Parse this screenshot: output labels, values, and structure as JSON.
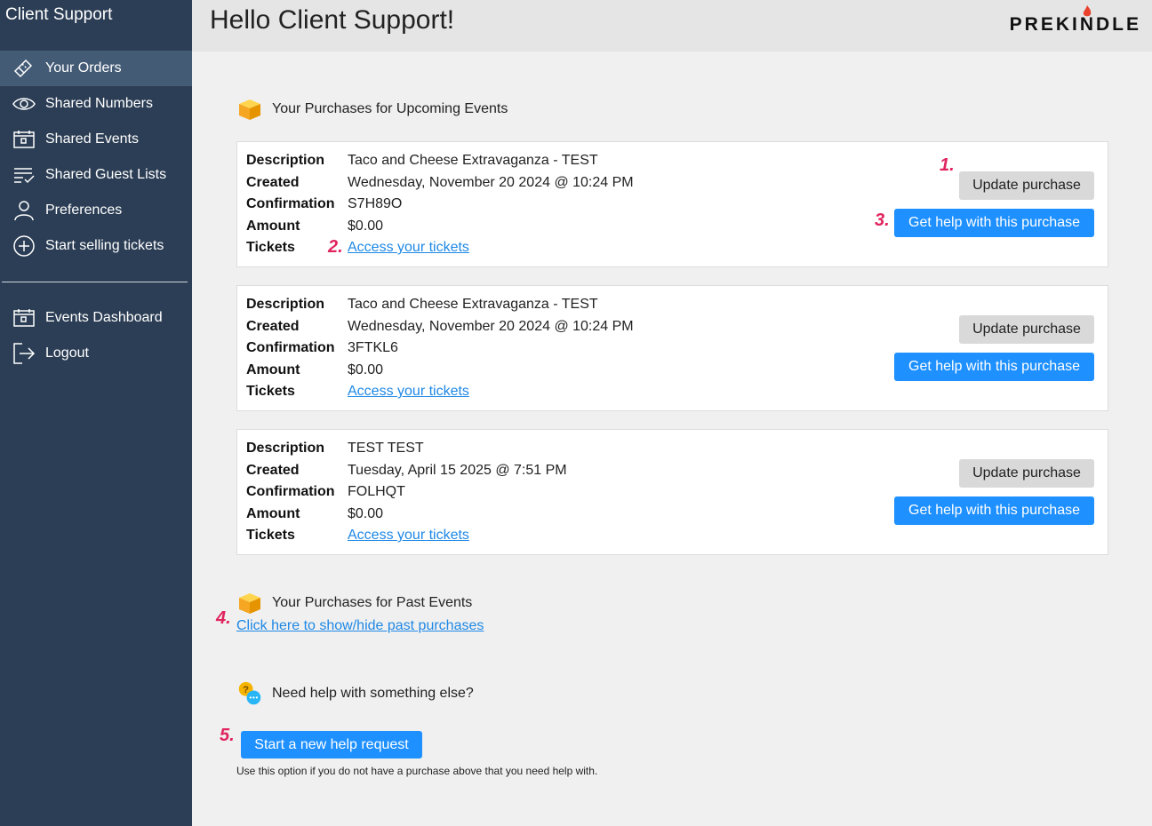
{
  "sidebar": {
    "title": "Client Support",
    "items": [
      {
        "label": "Your Orders",
        "icon": "ticket-icon"
      },
      {
        "label": "Shared Numbers",
        "icon": "eye-icon"
      },
      {
        "label": "Shared Events",
        "icon": "calendar-icon"
      },
      {
        "label": "Shared Guest Lists",
        "icon": "checklist-icon"
      },
      {
        "label": "Preferences",
        "icon": "user-icon"
      },
      {
        "label": "Start selling tickets",
        "icon": "plus-circle-icon"
      }
    ],
    "bottom_items": [
      {
        "label": "Events Dashboard",
        "icon": "calendar-icon"
      },
      {
        "label": "Logout",
        "icon": "logout-icon"
      }
    ]
  },
  "header": {
    "greeting": "Hello Client Support!",
    "brand": "PREKINDLE"
  },
  "upcoming": {
    "heading": "Your Purchases for Upcoming Events",
    "labels": {
      "description": "Description",
      "created": "Created",
      "confirmation": "Confirmation",
      "amount": "Amount",
      "tickets": "Tickets"
    },
    "tickets_link": "Access your tickets",
    "update_label": "Update purchase",
    "help_label": "Get help with this purchase",
    "purchases": [
      {
        "description": "Taco and Cheese Extravaganza - TEST",
        "created": "Wednesday, November 20 2024 @ 10:24 PM",
        "confirmation": "S7H89O",
        "amount": "$0.00"
      },
      {
        "description": "Taco and Cheese Extravaganza - TEST",
        "created": "Wednesday, November 20 2024 @ 10:24 PM",
        "confirmation": "3FTKL6",
        "amount": "$0.00"
      },
      {
        "description": "TEST TEST",
        "created": "Tuesday, April 15 2025 @ 7:51 PM",
        "confirmation": "FOLHQT",
        "amount": "$0.00"
      }
    ]
  },
  "past": {
    "heading": "Your Purchases for Past Events",
    "toggle_link": "Click here to show/hide past purchases"
  },
  "help": {
    "heading": "Need help with something else?",
    "button": "Start a new help request",
    "note": "Use this option if you do not have a purchase above that you need help with."
  },
  "annotations": [
    "1.",
    "2.",
    "3.",
    "4.",
    "5."
  ],
  "colors": {
    "sidebar": "#2c3e55",
    "sidebar_active": "#445b76",
    "primary": "#1e90ff",
    "link": "#1e88e5",
    "annotation": "#e0245e"
  }
}
